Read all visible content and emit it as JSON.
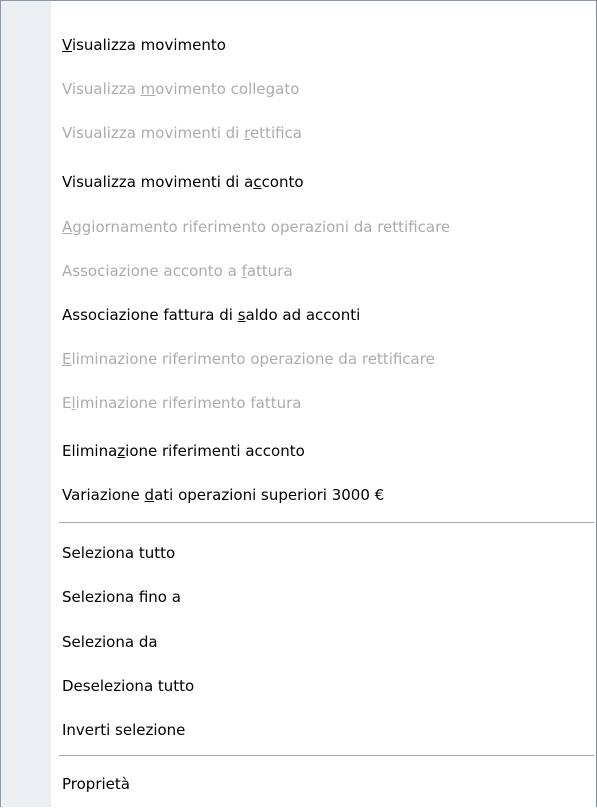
{
  "menu": {
    "items": [
      {
        "pre": "",
        "key": "V",
        "post": "isualizza movimento",
        "enabled": true
      },
      {
        "pre": "Visualizza ",
        "key": "m",
        "post": "ovimento collegato",
        "enabled": false
      },
      {
        "pre": "Visualizza movimenti di ",
        "key": "r",
        "post": "ettifica",
        "enabled": false
      },
      {
        "pre": "Visualizza movimenti di a",
        "key": "c",
        "post": "conto",
        "enabled": true
      },
      {
        "pre": "",
        "key": "A",
        "post": "ggiornamento riferimento operazioni da rettificare",
        "enabled": false
      },
      {
        "pre": "Associazione acconto a ",
        "key": "f",
        "post": "attura",
        "enabled": false
      },
      {
        "pre": "Associazione fattura di ",
        "key": "s",
        "post": "aldo ad acconti",
        "enabled": true
      },
      {
        "pre": "",
        "key": "E",
        "post": "liminazione riferimento operazione da rettificare",
        "enabled": false
      },
      {
        "pre": "E",
        "key": "l",
        "post": "iminazione riferimento fattura",
        "enabled": false
      },
      {
        "pre": "Elimina",
        "key": "z",
        "post": "ione riferimenti acconto",
        "enabled": true
      },
      {
        "pre": "Variazione ",
        "key": "d",
        "post": "ati operazioni superiori 3000 €",
        "enabled": true
      },
      {
        "pre": "Seleziona tutto",
        "key": "",
        "post": "",
        "enabled": true
      },
      {
        "pre": "Seleziona fino a",
        "key": "",
        "post": "",
        "enabled": true
      },
      {
        "pre": "Seleziona da",
        "key": "",
        "post": "",
        "enabled": true
      },
      {
        "pre": "Deseleziona tutto",
        "key": "",
        "post": "",
        "enabled": true
      },
      {
        "pre": "Inverti selezione",
        "key": "",
        "post": "",
        "enabled": true
      },
      {
        "pre": "Proprietà",
        "key": "",
        "post": "",
        "enabled": true
      }
    ]
  }
}
